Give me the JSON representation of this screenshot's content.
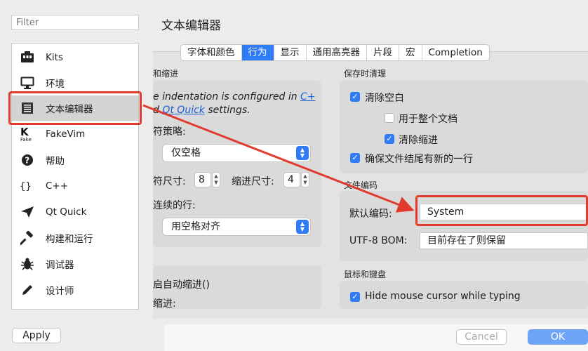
{
  "filter": {
    "placeholder": "Filter"
  },
  "categories": [
    {
      "label": "Kits",
      "icon": "kits-icon"
    },
    {
      "label": "环境",
      "icon": "monitor-icon"
    },
    {
      "label": "文本编辑器",
      "icon": "text-editor-icon",
      "selected": true
    },
    {
      "label": "FakeVim",
      "icon": "fakevim-icon"
    },
    {
      "label": "帮助",
      "icon": "help-icon"
    },
    {
      "label": "C++",
      "icon": "braces-icon"
    },
    {
      "label": "Qt Quick",
      "icon": "qtquick-icon"
    },
    {
      "label": "构建和运行",
      "icon": "hammer-icon"
    },
    {
      "label": "调试器",
      "icon": "bug-icon"
    },
    {
      "label": "设计师",
      "icon": "pen-icon"
    }
  ],
  "apply_label": "Apply",
  "page_title": "文本编辑器",
  "tabs": [
    "字体和颜色",
    "行为",
    "显示",
    "通用高亮器",
    "片段",
    "宏",
    "Completion"
  ],
  "indent": {
    "section_title": "和缩进",
    "note_part1": "e indentation is configured in ",
    "note_link1": "C+",
    "note_part2": "d ",
    "note_link2": "Qt Quick",
    "note_part3": " settings.",
    "tab_policy_label": "符策略:",
    "tab_policy_value": "仅空格",
    "tab_size_label": "符尺寸:",
    "tab_size_value": "8",
    "indent_size_label": "缩进尺寸:",
    "indent_size_value": "4",
    "continuation_label": "连续的行:",
    "continuation_value": "用空格对齐"
  },
  "auto_indent": {
    "title": "启自动缩进()",
    "sub": "缩进:"
  },
  "save_cleanup": {
    "section_title": "保存时清理",
    "items": [
      {
        "label": "清除空白",
        "checked": true
      },
      {
        "label": "用于整个文档",
        "checked": false
      },
      {
        "label": "清除缩进",
        "checked": true
      },
      {
        "label": "确保文件结尾有新的一行",
        "checked": true
      }
    ]
  },
  "encoding": {
    "section_title": "文件编码",
    "default_label": "默认编码:",
    "default_value": "System",
    "bom_label": "UTF-8 BOM:",
    "bom_value": "目前存在了则保留"
  },
  "mouse_keyboard": {
    "section_title": "鼠标和键盘",
    "hide_cursor_label": "Hide mouse cursor while typing",
    "hide_cursor_checked": true
  },
  "buttons": {
    "cancel": "Cancel",
    "ok": "OK"
  },
  "annotation_color": "#e03b2e",
  "accent_color": "#2f7cf6"
}
